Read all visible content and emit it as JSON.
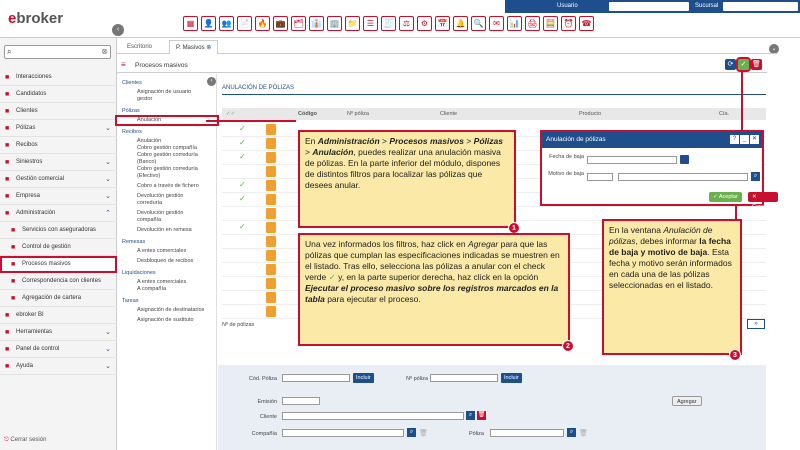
{
  "app": {
    "logo_text": "ebroker",
    "topstrip": {
      "usuario_label": "Usuario",
      "sucursal_label": "Sucursal"
    }
  },
  "search": {
    "placeholder": ""
  },
  "sidebar": {
    "items": [
      {
        "label": "Interacciones",
        "icon": "interactions-icon",
        "chevron": false
      },
      {
        "label": "Candidatos",
        "icon": "candidates-icon",
        "chevron": false
      },
      {
        "label": "Clientes",
        "icon": "clients-icon",
        "chevron": false
      },
      {
        "label": "Pólizas",
        "icon": "policies-icon",
        "chevron": true
      },
      {
        "label": "Recibos",
        "icon": "receipts-icon",
        "chevron": false
      },
      {
        "label": "Siniestros",
        "icon": "claims-icon",
        "chevron": true
      },
      {
        "label": "Gestión comercial",
        "icon": "commercial-icon",
        "chevron": true
      },
      {
        "label": "Empresa",
        "icon": "company-icon",
        "chevron": true
      },
      {
        "label": "Administración",
        "icon": "admin-icon",
        "chevron": true,
        "expanded": true
      },
      {
        "label": "Servicios con aseguradoras",
        "icon": "services-icon",
        "sub": true
      },
      {
        "label": "Control de gestión",
        "icon": "control-icon",
        "sub": true
      },
      {
        "label": "Procesos masivos",
        "icon": "mass-process-icon",
        "sub": true,
        "active": true
      },
      {
        "label": "Correspondencia con clientes",
        "icon": "mail-icon",
        "sub": true
      },
      {
        "label": "Agregación de cartera",
        "icon": "portfolio-icon",
        "sub": true
      },
      {
        "label": "ebroker BI",
        "icon": "bi-icon",
        "chevron": false
      },
      {
        "label": "Herramientas",
        "icon": "tools-icon",
        "chevron": true
      },
      {
        "label": "Panel de control",
        "icon": "panel-icon",
        "chevron": true
      },
      {
        "label": "Ayuda",
        "icon": "help-icon",
        "chevron": true
      }
    ],
    "logout": "Cerrar sesión"
  },
  "tabs": [
    {
      "label": "Escritorio"
    },
    {
      "label": "P. Masivos"
    }
  ],
  "module": {
    "title": "Procesos masivos",
    "section": "ANULACIÓN DE PÓLIZAS"
  },
  "tree": [
    {
      "label": "Clientes",
      "h": true
    },
    {
      "label": "Asignación de usuario"
    },
    {
      "label": "gestor"
    },
    {
      "label": "Pólizas",
      "h": true
    },
    {
      "label": "Anulación",
      "active": true
    },
    {
      "label": "Recibos",
      "h": true
    },
    {
      "label": "Anulación"
    },
    {
      "label": "Cobro gestión compañía"
    },
    {
      "label": "Cobro gestión correduría"
    },
    {
      "label": "(Banco)"
    },
    {
      "label": "Cobro gestión correduría"
    },
    {
      "label": "(Efectivo)"
    },
    {
      "label": "Cobro a través de fichero"
    },
    {
      "label": "Devolución gestión"
    },
    {
      "label": "correduría"
    },
    {
      "label": "Devolución gestión"
    },
    {
      "label": "compañía"
    },
    {
      "label": "Devolución en remesa"
    },
    {
      "label": "Remesas",
      "h": true
    },
    {
      "label": "A entes comerciales"
    },
    {
      "label": "Desbloqueo de recibos"
    },
    {
      "label": "Liquidaciones",
      "h": true
    },
    {
      "label": "A entes comerciales"
    },
    {
      "label": "A compañía"
    },
    {
      "label": "Tareas",
      "h": true
    },
    {
      "label": "Asignación de destinatarios"
    },
    {
      "label": "Asignación de sustituto"
    }
  ],
  "table": {
    "headers": [
      "Código",
      "Nº póliza",
      "Cliente",
      "Producto",
      "Cía."
    ],
    "rows_checked": [
      true,
      true,
      true,
      false,
      true,
      true,
      false,
      true,
      false,
      false,
      false,
      false,
      false,
      false
    ],
    "footer_label": "Nº de pólizas"
  },
  "callouts": {
    "c1": {
      "parts": [
        "En ",
        "Administración",
        " > ",
        "Procesos masivos",
        " > ",
        "Pólizas",
        " > ",
        "Anulación",
        ", puedes realizar una anulación masiva de pólizas. En la parte inferior del módulo, dispones de distintos filtros para localizar las pólizas que desees anular."
      ],
      "num": "1"
    },
    "c2": {
      "p1": "Una vez informados los filtros, haz click en ",
      "p2": "Agregar",
      "p3": " para que las pólizas que cumplan las especificaciones indicadas se muestren en el listado. Tras ello, selecciona las pólizas a anular con el check verde ",
      "p4": "✓",
      "p5": " y, en la parte superior derecha, haz click en la opción ",
      "p6": "Ejecutar el proceso masivo sobre los registros marcados en la tabla",
      "p7": " para ejecutar el proceso.",
      "num": "2"
    },
    "c3": {
      "p1": "En la ventana ",
      "p2": "Anulación de pólizas",
      ", ": "",
      "p3": ", debes informar ",
      "p4": "la fecha de baja y motivo de baja",
      "p5": ". Esta fecha y motivo serán informados en cada una de las pólizas seleccionadas en el listado.",
      "num": "3"
    }
  },
  "dialog": {
    "title": "Anulación de pólizas",
    "fecha_label": "Fecha de baja",
    "motivo_label": "Motivo de baja",
    "aceptar": "Aceptar",
    "cancelar": "Cancelar"
  },
  "filters": {
    "cod_poliza": "Cód. Póliza",
    "incluir1": "Incluir",
    "n_poliza": "Nº póliza",
    "incluir2": "Incluir",
    "emision": "Emisión",
    "cliente": "Cliente",
    "compania": "Compañía",
    "poliza": "Póliza",
    "agregar": "Agregar"
  },
  "colors": {
    "brand": "#c8102e",
    "navy": "#1f4e8c",
    "callout": "#fbe9a8"
  }
}
